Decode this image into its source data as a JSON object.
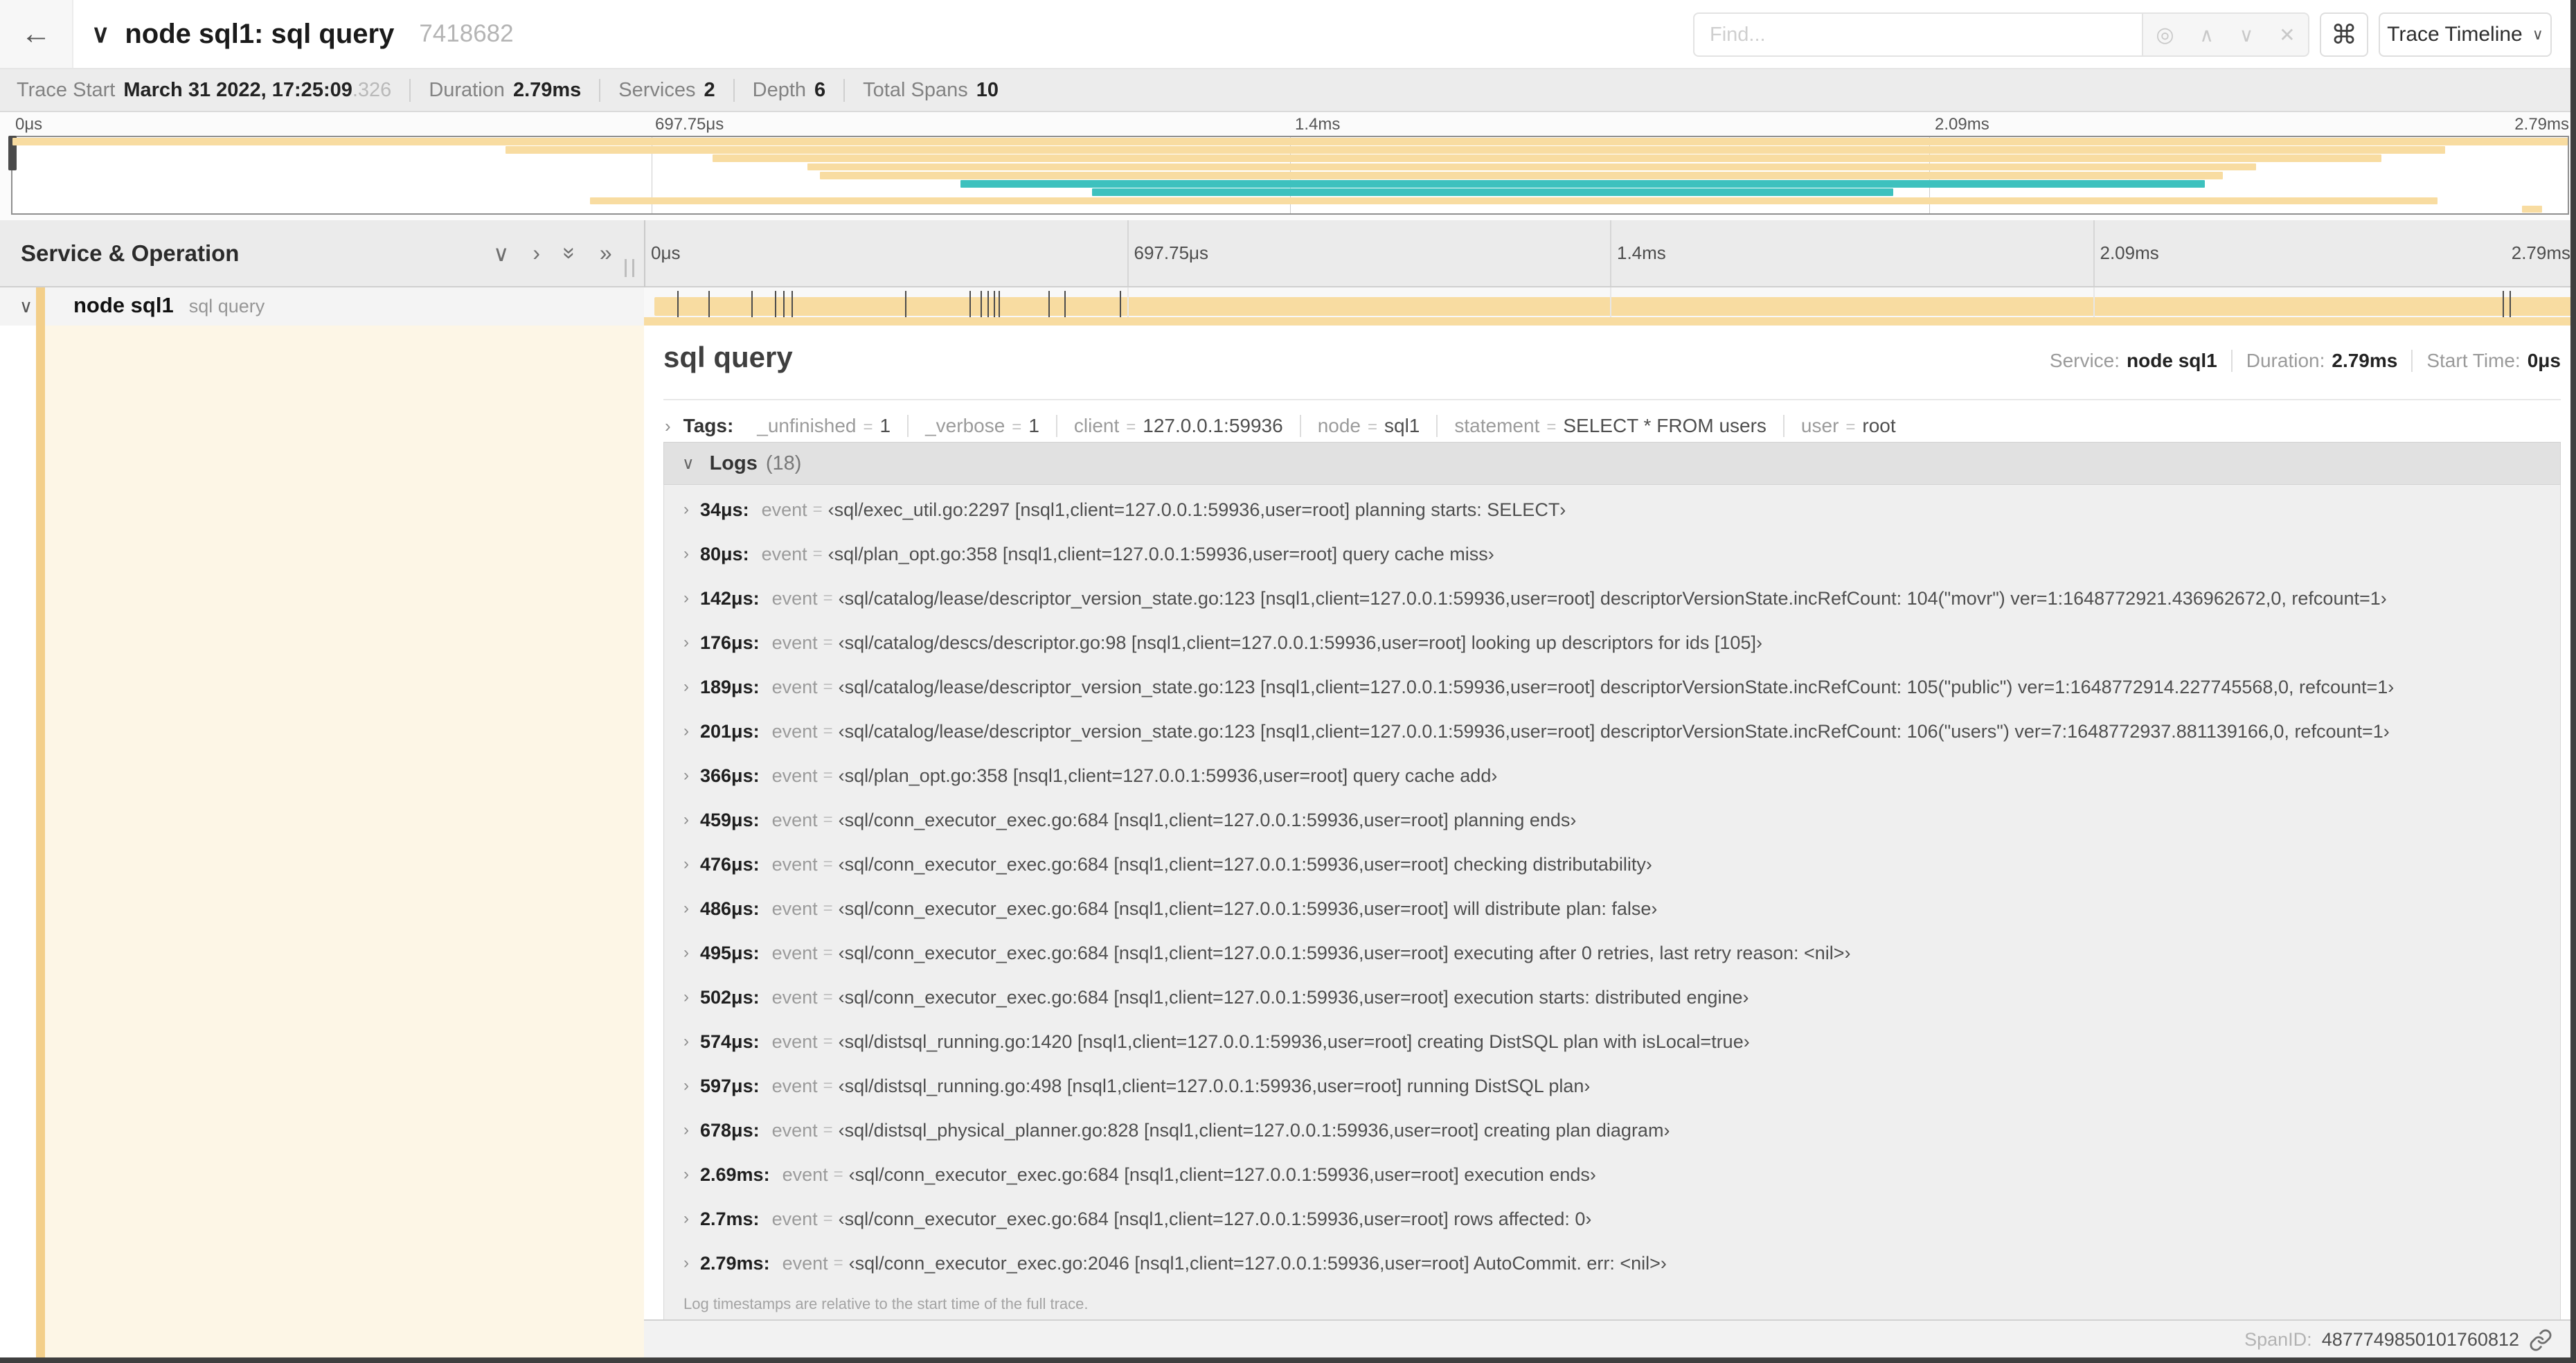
{
  "colors": {
    "tan": "#f8dca1",
    "tan_dark": "#f3cf8a",
    "teal": "#3dc1be",
    "cream": "#fdf6e6"
  },
  "icons": {
    "back": "←",
    "chevron_down": "∨",
    "chevron_right": "›",
    "chevron_up": "∧",
    "double_chevron_right": "»",
    "close": "✕",
    "command": "⌘",
    "target": "◎"
  },
  "header": {
    "title": "node sql1: sql query",
    "trace_id": "7418682",
    "find_placeholder": "Find...",
    "view_label": "Trace Timeline"
  },
  "trace_meta": {
    "items": [
      {
        "label": "Trace Start",
        "value": "March 31 2022, 17:25:09",
        "suffix": ".326"
      },
      {
        "label": "Duration",
        "value": "2.79ms",
        "suffix": ""
      },
      {
        "label": "Services",
        "value": "2",
        "suffix": ""
      },
      {
        "label": "Depth",
        "value": "6",
        "suffix": ""
      },
      {
        "label": "Total Spans",
        "value": "10",
        "suffix": ""
      }
    ]
  },
  "timeline": {
    "ticks": [
      {
        "label": "0μs",
        "pos": 0
      },
      {
        "label": "697.75μs",
        "pos": 0.25
      },
      {
        "label": "1.4ms",
        "pos": 0.5
      },
      {
        "label": "2.09ms",
        "pos": 0.75
      },
      {
        "label": "2.79ms",
        "pos": 1
      }
    ],
    "grid_positions": [
      0.25,
      0.5,
      0.75
    ]
  },
  "minimap": {
    "rows": 9,
    "spans": [
      {
        "row": 0,
        "start": 0,
        "end": 1,
        "color": "tan"
      },
      {
        "row": 1,
        "start": 0.193,
        "end": 0.952,
        "color": "tan"
      },
      {
        "row": 2,
        "start": 0.274,
        "end": 0.927,
        "color": "tan"
      },
      {
        "row": 3,
        "start": 0.311,
        "end": 0.878,
        "color": "tan"
      },
      {
        "row": 4,
        "start": 0.316,
        "end": 0.865,
        "color": "tan"
      },
      {
        "row": 5,
        "start": 0.371,
        "end": 0.858,
        "color": "teal"
      },
      {
        "row": 6,
        "start": 0.4225,
        "end": 0.736,
        "color": "teal"
      },
      {
        "row": 7,
        "start": 0.226,
        "end": 0.949,
        "color": "tan"
      },
      {
        "row": 8,
        "start": 0.982,
        "end": 0.99,
        "color": "tan"
      }
    ]
  },
  "left_panel": {
    "header_label": "Service & Operation",
    "service": "node sql1",
    "operation": "sql query"
  },
  "span_row": {
    "tick_fractions": [
      0.0122,
      0.0287,
      0.0509,
      0.0631,
      0.0677,
      0.072,
      0.1312,
      0.1645,
      0.1706,
      0.1742,
      0.1774,
      0.1799,
      0.2057,
      0.214,
      0.243,
      0.9642,
      0.9677,
      1.0
    ]
  },
  "detail": {
    "title": "sql query",
    "service_label": "Service:",
    "service": "node sql1",
    "duration_label": "Duration:",
    "duration": "2.79ms",
    "start_label": "Start Time:",
    "start": "0μs",
    "tags_label": "Tags:",
    "tags": [
      {
        "key": "_unfinished",
        "value": "1"
      },
      {
        "key": "_verbose",
        "value": "1"
      },
      {
        "key": "client",
        "value": "127.0.0.1:59936"
      },
      {
        "key": "node",
        "value": "sql1"
      },
      {
        "key": "statement",
        "value": "SELECT * FROM users"
      },
      {
        "key": "user",
        "value": "root"
      }
    ],
    "logs_label": "Logs",
    "logs_count": "(18)",
    "log_field": "event",
    "eq": "=",
    "logs": [
      {
        "time": "34μs:",
        "message": "‹sql/exec_util.go:2297 [nsql1,client=127.0.0.1:59936,user=root] planning starts: SELECT›"
      },
      {
        "time": "80μs:",
        "message": "‹sql/plan_opt.go:358 [nsql1,client=127.0.0.1:59936,user=root] query cache miss›"
      },
      {
        "time": "142μs:",
        "message": "‹sql/catalog/lease/descriptor_version_state.go:123 [nsql1,client=127.0.0.1:59936,user=root] descriptorVersionState.incRefCount: 104(\"movr\") ver=1:1648772921.436962672,0, refcount=1›"
      },
      {
        "time": "176μs:",
        "message": "‹sql/catalog/descs/descriptor.go:98 [nsql1,client=127.0.0.1:59936,user=root] looking up descriptors for ids [105]›"
      },
      {
        "time": "189μs:",
        "message": "‹sql/catalog/lease/descriptor_version_state.go:123 [nsql1,client=127.0.0.1:59936,user=root] descriptorVersionState.incRefCount: 105(\"public\") ver=1:1648772914.227745568,0, refcount=1›"
      },
      {
        "time": "201μs:",
        "message": "‹sql/catalog/lease/descriptor_version_state.go:123 [nsql1,client=127.0.0.1:59936,user=root] descriptorVersionState.incRefCount: 106(\"users\") ver=7:1648772937.881139166,0, refcount=1›"
      },
      {
        "time": "366μs:",
        "message": "‹sql/plan_opt.go:358 [nsql1,client=127.0.0.1:59936,user=root] query cache add›"
      },
      {
        "time": "459μs:",
        "message": "‹sql/conn_executor_exec.go:684 [nsql1,client=127.0.0.1:59936,user=root] planning ends›"
      },
      {
        "time": "476μs:",
        "message": "‹sql/conn_executor_exec.go:684 [nsql1,client=127.0.0.1:59936,user=root] checking distributability›"
      },
      {
        "time": "486μs:",
        "message": "‹sql/conn_executor_exec.go:684 [nsql1,client=127.0.0.1:59936,user=root] will distribute plan: false›"
      },
      {
        "time": "495μs:",
        "message": "‹sql/conn_executor_exec.go:684 [nsql1,client=127.0.0.1:59936,user=root] executing after 0 retries, last retry reason: <nil>›"
      },
      {
        "time": "502μs:",
        "message": "‹sql/conn_executor_exec.go:684 [nsql1,client=127.0.0.1:59936,user=root] execution starts: distributed engine›"
      },
      {
        "time": "574μs:",
        "message": "‹sql/distsql_running.go:1420 [nsql1,client=127.0.0.1:59936,user=root] creating DistSQL plan with isLocal=true›"
      },
      {
        "time": "597μs:",
        "message": "‹sql/distsql_running.go:498 [nsql1,client=127.0.0.1:59936,user=root] running DistSQL plan›"
      },
      {
        "time": "678μs:",
        "message": "‹sql/distsql_physical_planner.go:828 [nsql1,client=127.0.0.1:59936,user=root] creating plan diagram›"
      },
      {
        "time": "2.69ms:",
        "message": "‹sql/conn_executor_exec.go:684 [nsql1,client=127.0.0.1:59936,user=root] execution ends›"
      },
      {
        "time": "2.7ms:",
        "message": "‹sql/conn_executor_exec.go:684 [nsql1,client=127.0.0.1:59936,user=root] rows affected: 0›"
      },
      {
        "time": "2.79ms:",
        "message": "‹sql/conn_executor_exec.go:2046 [nsql1,client=127.0.0.1:59936,user=root] AutoCommit. err: <nil>›"
      }
    ],
    "footer_note": "Log timestamps are relative to the start time of the full trace.",
    "span_id_label": "SpanID:",
    "span_id": "4877749850101760812"
  }
}
